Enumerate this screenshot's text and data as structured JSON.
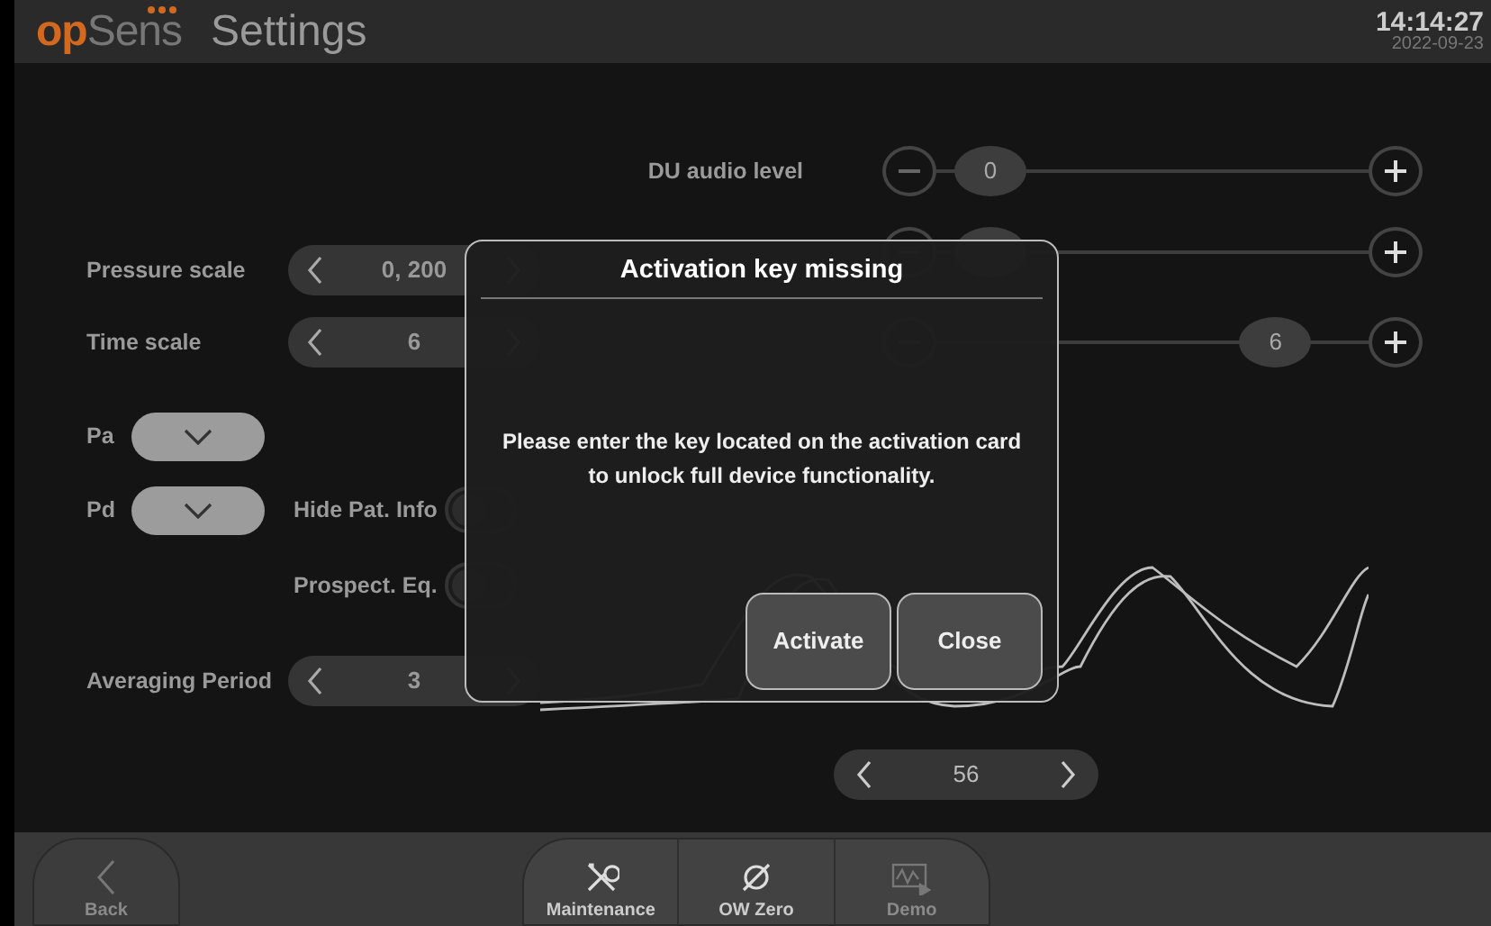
{
  "header": {
    "logo": {
      "part_1": "op",
      "part_2": "Sens"
    },
    "title": "Settings",
    "time": "14:14:27",
    "date": "2022-09-23"
  },
  "steppers": [
    {
      "label": "Pressure scale",
      "value": "0, 200"
    },
    {
      "label": "Time scale",
      "value": "6"
    }
  ],
  "signal_selectors": [
    {
      "label": "Pa"
    },
    {
      "label": "Pd"
    }
  ],
  "toggles": [
    {
      "label": "Hide Pat. Info",
      "on": false
    },
    {
      "label": "Prospect. Eq.",
      "on": false
    }
  ],
  "averaging": {
    "label": "Averaging Period",
    "value": "3"
  },
  "sliders": [
    {
      "label": "DU audio level",
      "value": "0",
      "level": 0
    },
    {
      "level": 0
    },
    {
      "value": "6",
      "level": 0.88
    }
  ],
  "pager": {
    "value": "56"
  },
  "dialog": {
    "title": "Activation key missing",
    "message": "Please enter the key located on the activation card\nto unlock full device functionality.",
    "buttons": [
      "Activate",
      "Close"
    ]
  },
  "footer": {
    "left": [
      {
        "kind": "back",
        "label": "Back",
        "disabled": true
      }
    ],
    "center": [
      {
        "kind": "maintenance",
        "label": "Maintenance",
        "disabled": false
      },
      {
        "kind": "zero",
        "label": "OW Zero",
        "disabled": false
      },
      {
        "kind": "demo",
        "label": "Demo",
        "disabled": true
      }
    ]
  }
}
